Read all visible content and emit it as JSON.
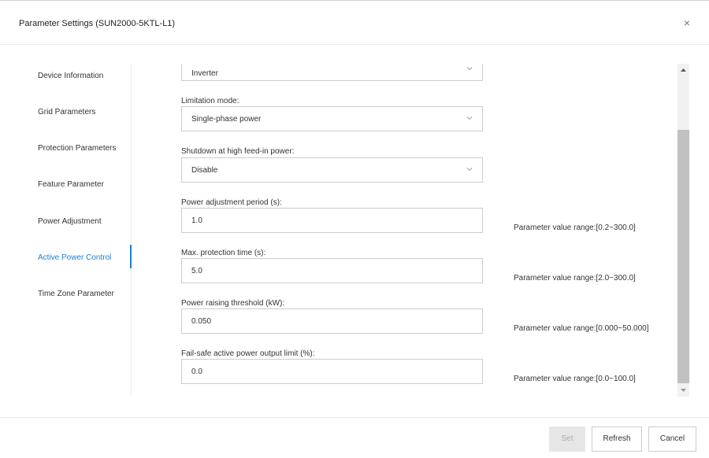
{
  "dialog": {
    "title": "Parameter Settings (SUN2000-5KTL-L1)",
    "close_glyph": "×"
  },
  "nav": {
    "items": [
      {
        "label": "Device Information"
      },
      {
        "label": "Grid Parameters"
      },
      {
        "label": "Protection Parameters"
      },
      {
        "label": "Feature Parameter"
      },
      {
        "label": "Power Adjustment"
      },
      {
        "label": "Active Power Control"
      },
      {
        "label": "Time Zone Parameter"
      }
    ],
    "active_item": "Active Power Control",
    "accent_color": "#1a7fd6"
  },
  "form": {
    "top_select": {
      "value": "Inverter"
    },
    "limitation_mode": {
      "label": "Limitation mode:",
      "value": "Single-phase power"
    },
    "shutdown": {
      "label": "Shutdown at high feed-in power:",
      "value": "Disable"
    },
    "adjust_period": {
      "label": "Power adjustment period (s):",
      "value": "1.0",
      "range": "Parameter value range:[0.2~300.0]"
    },
    "protection_time": {
      "label": "Max. protection time (s):",
      "value": "5.0",
      "range": "Parameter value range:[2.0~300.0]"
    },
    "raising_threshold": {
      "label": "Power raising threshold (kW):",
      "value": "0.050",
      "range": "Parameter value range:[0.000~50.000]"
    },
    "failsafe_limit": {
      "label": "Fail-safe active power output limit (%):",
      "value": "0.0",
      "range": "Parameter value range:[0.0~100.0]"
    }
  },
  "footer": {
    "set_label": "Set",
    "refresh_label": "Refresh",
    "cancel_label": "Cancel"
  }
}
